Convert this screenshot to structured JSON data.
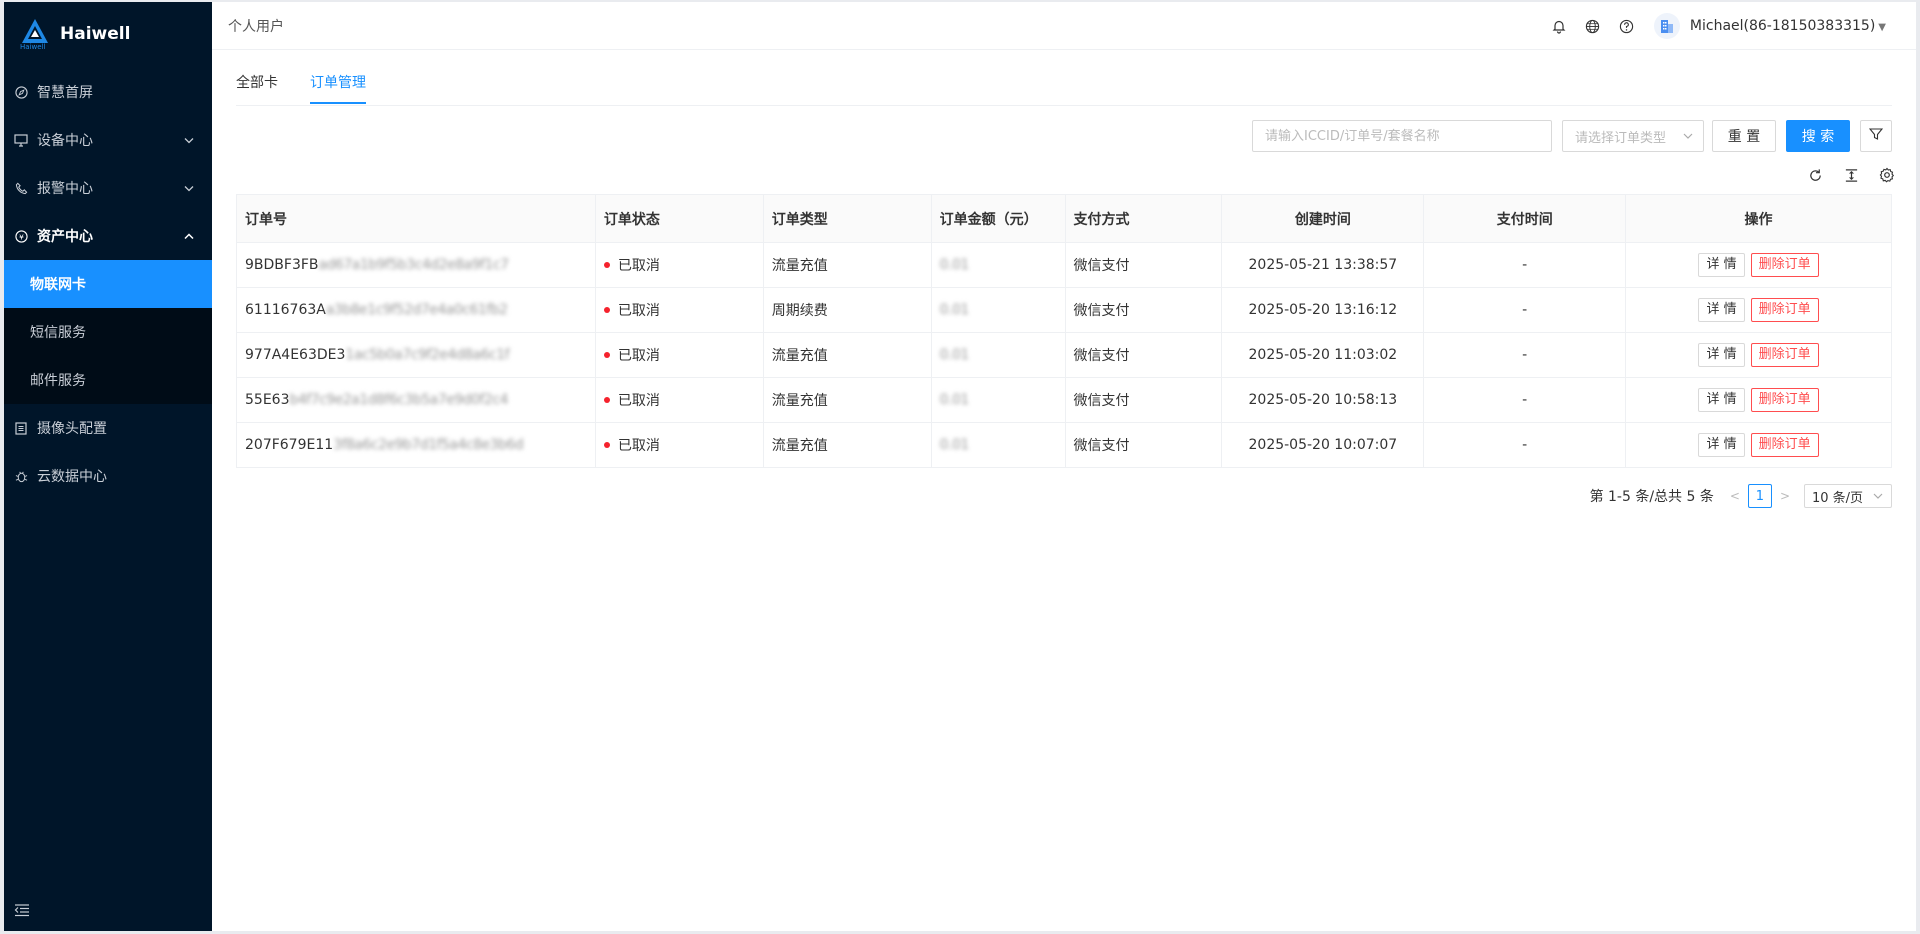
{
  "app": {
    "logo_text": "Haiwell",
    "logo_sub": "Haiwell"
  },
  "sidebar": {
    "items": [
      {
        "label": "智慧首屏",
        "icon": "compass-icon"
      },
      {
        "label": "设备中心",
        "icon": "monitor-icon"
      },
      {
        "label": "报警中心",
        "icon": "phone-icon"
      },
      {
        "label": "资产中心",
        "icon": "asset-icon"
      },
      {
        "label": "摄像头配置",
        "icon": "camera-config-icon"
      },
      {
        "label": "云数据中心",
        "icon": "bug-icon"
      }
    ],
    "submenu": [
      {
        "label": "物联网卡"
      },
      {
        "label": "短信服务"
      },
      {
        "label": "邮件服务"
      }
    ]
  },
  "header": {
    "title": "个人用户",
    "user": "Michael(86-18150383315)"
  },
  "tabs": [
    {
      "label": "全部卡"
    },
    {
      "label": "订单管理"
    }
  ],
  "filters": {
    "search_placeholder": "请输入ICCID/订单号/套餐名称",
    "type_placeholder": "请选择订单类型",
    "reset_label": "重 置",
    "search_label": "搜 索"
  },
  "table": {
    "columns": [
      "订单号",
      "订单状态",
      "订单类型",
      "订单金额（元）",
      "支付方式",
      "创建时间",
      "支付时间",
      "操作"
    ],
    "rows": [
      {
        "order_visible": "9BDBF3FB",
        "order_hidden": "ad67a1b9f5b3c4d2e8a9f1c7",
        "status": "已取消",
        "type": "流量充值",
        "amount": "0.01",
        "pay": "微信支付",
        "created": "2025-05-21 13:38:57",
        "paid": "-"
      },
      {
        "order_visible": "61116763A",
        "order_hidden": "a3b8e1c9f52d7e4a0c61fb2",
        "status": "已取消",
        "type": "周期续费",
        "amount": "0.01",
        "pay": "微信支付",
        "created": "2025-05-20 13:16:12",
        "paid": "-"
      },
      {
        "order_visible": "977A4E63DE3",
        "order_hidden": "1ac5b0a7c9f2e4d8a6c1f",
        "status": "已取消",
        "type": "流量充值",
        "amount": "0.01",
        "pay": "微信支付",
        "created": "2025-05-20 11:03:02",
        "paid": "-"
      },
      {
        "order_visible": "55E63",
        "order_hidden": "b4f7c9e2a1d8f6c3b5a7e9d0f2c4",
        "status": "已取消",
        "type": "流量充值",
        "amount": "0.01",
        "pay": "微信支付",
        "created": "2025-05-20 10:58:13",
        "paid": "-"
      },
      {
        "order_visible": "207F679E11",
        "order_hidden": "3f8a6c2e9b7d1f5a4c8e3b6d",
        "status": "已取消",
        "type": "流量充值",
        "amount": "0.01",
        "pay": "微信支付",
        "created": "2025-05-20 10:07:07",
        "paid": "-"
      }
    ],
    "detail_label": "详 情",
    "delete_label": "删除订单"
  },
  "pagination": {
    "summary": "第 1-5 条/总共 5 条",
    "current": "1",
    "page_size": "10 条/页"
  },
  "colors": {
    "sidebar_bg": "#001529",
    "accent": "#1890ff",
    "danger": "#ff4d4f"
  }
}
